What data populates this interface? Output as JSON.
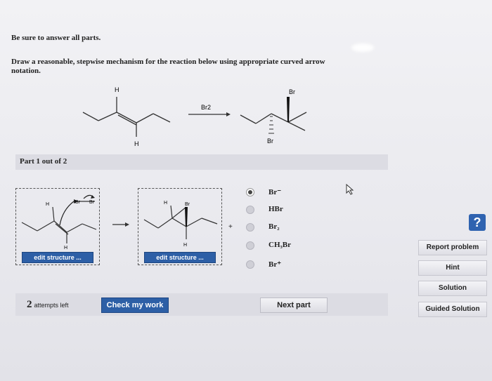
{
  "instructions": {
    "line1": "Be sure to answer all parts.",
    "line2": "Draw a reasonable, stepwise mechanism for the reaction below using appropriate curved arrow",
    "line3": "notation."
  },
  "reaction": {
    "reactant_h_top": "H",
    "reactant_h_bottom": "H",
    "reagent": "Br2",
    "product_br_top": "Br",
    "product_br_bottom": "Br"
  },
  "part": {
    "label": "Part 1 out of 2"
  },
  "structure1": {
    "h_label": "H",
    "h_bottom": "H",
    "br_label": "Br",
    "br2_label": "Br",
    "edit_label": "edit structure ..."
  },
  "structure2": {
    "h_label": "H",
    "h_bottom": "H",
    "br_label": "Br",
    "edit_label": "edit structure ..."
  },
  "plus": "+",
  "options": [
    {
      "label": "Br⁻",
      "selected": true
    },
    {
      "label": "HBr",
      "selected": false
    },
    {
      "label": "Br₂",
      "selected": false
    },
    {
      "label": "CH₃Br",
      "selected": false
    },
    {
      "label": "Br⁺",
      "selected": false
    }
  ],
  "sidebar": {
    "help": "?",
    "report": "Report problem",
    "hint": "Hint",
    "solution": "Solution",
    "guided": "Guided Solution"
  },
  "bottom": {
    "attempts_count": "2",
    "attempts_text": "attempts left",
    "check": "Check my work",
    "next": "Next part"
  }
}
